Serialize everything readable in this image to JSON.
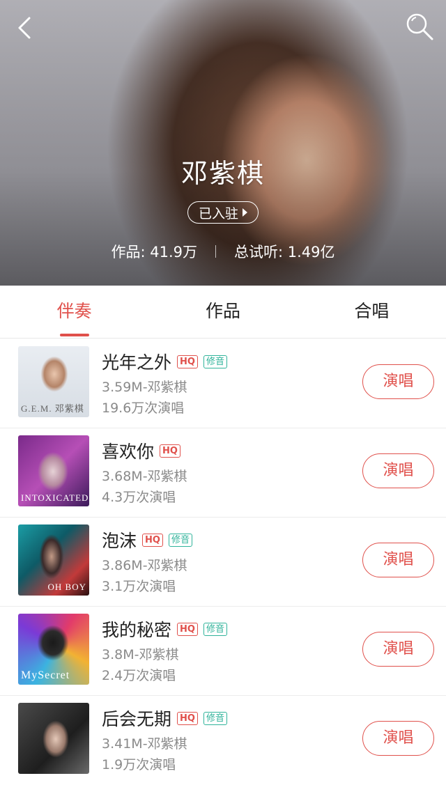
{
  "header": {
    "artist_name": "邓紫棋",
    "verified_label": "已入驻",
    "works_stat": "作品: 41.9万",
    "listen_stat": "总试听: 1.49亿",
    "back_icon": "chevron-left-icon",
    "search_icon": "search-icon"
  },
  "tabs": [
    {
      "label": "伴奏",
      "active": true
    },
    {
      "label": "作品",
      "active": false
    },
    {
      "label": "合唱",
      "active": false
    }
  ],
  "colors": {
    "accent": "#e0504b",
    "repair_badge": "#2fb39a"
  },
  "songs": [
    {
      "title": "光年之外",
      "hq": "HQ",
      "repair": "修音",
      "size_artist": "3.59M-邓紫棋",
      "plays": "19.6万次演唱",
      "button": "演唱",
      "cover_text": "G.E.M. 邓紫棋"
    },
    {
      "title": "喜欢你",
      "hq": "HQ",
      "repair": "",
      "size_artist": "3.68M-邓紫棋",
      "plays": "4.3万次演唱",
      "button": "演唱",
      "cover_text": "INTOXICATED"
    },
    {
      "title": "泡沫",
      "hq": "HQ",
      "repair": "修音",
      "size_artist": "3.86M-邓紫棋",
      "plays": "3.1万次演唱",
      "button": "演唱",
      "cover_text": "OH BOY"
    },
    {
      "title": "我的秘密",
      "hq": "HQ",
      "repair": "修音",
      "size_artist": "3.8M-邓紫棋",
      "plays": "2.4万次演唱",
      "button": "演唱",
      "cover_text": "MySecret"
    },
    {
      "title": "后会无期",
      "hq": "HQ",
      "repair": "修音",
      "size_artist": "3.41M-邓紫棋",
      "plays": "1.9万次演唱",
      "button": "演唱",
      "cover_text": ""
    }
  ]
}
